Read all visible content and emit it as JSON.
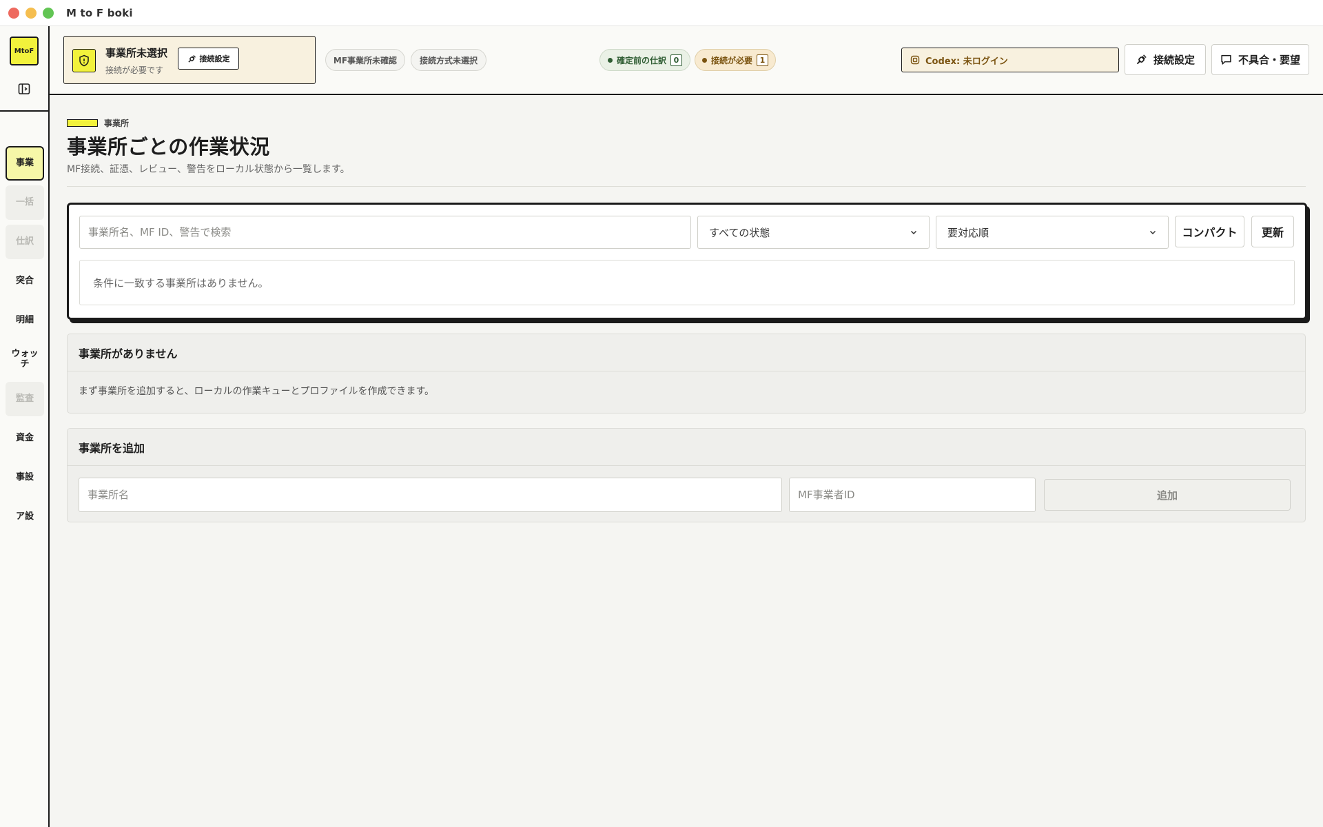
{
  "window": {
    "title": "M to F boki"
  },
  "sidebar": {
    "brand": "MtoF",
    "items": [
      {
        "label": "事業",
        "state": "active"
      },
      {
        "label": "一括",
        "state": "disabled"
      },
      {
        "label": "仕訳",
        "state": "disabled"
      },
      {
        "label": "突合",
        "state": "normal"
      },
      {
        "label": "明細",
        "state": "normal"
      },
      {
        "label": "ウォッチ",
        "state": "normal"
      },
      {
        "label": "監査",
        "state": "disabled"
      },
      {
        "label": "資金",
        "state": "normal"
      },
      {
        "label": "事設",
        "state": "normal"
      },
      {
        "label": "ア設",
        "state": "normal"
      }
    ]
  },
  "header": {
    "office": {
      "title": "事業所未選択",
      "subtitle": "接続が必要です",
      "button_label": "接続設定"
    },
    "pills": {
      "mf_office": "MF事業所未確認",
      "connection_method": "接続方式未選択",
      "pending_label": "確定前の仕訳",
      "pending_count": "0",
      "connect_label": "接続が必要",
      "connect_count": "1"
    },
    "codex_label": "Codex: 未ログイン",
    "connect_settings_label": "接続設定",
    "feedback_label": "不具合・要望"
  },
  "main": {
    "section_label": "事業所",
    "title": "事業所ごとの作業状況",
    "description": "MF接続、証憑、レビュー、警告をローカル状態から一覧します。",
    "filter": {
      "search_placeholder": "事業所名、MF ID、警告で検索",
      "status_select": "すべての状態",
      "sort_select": "要対応順",
      "compact_label": "コンパクト",
      "refresh_label": "更新",
      "empty_message": "条件に一致する事業所はありません。"
    },
    "no_office": {
      "title": "事業所がありません",
      "message": "まず事業所を追加すると、ローカルの作業キューとプロファイルを作成できます。"
    },
    "add_office": {
      "title": "事業所を追加",
      "name_placeholder": "事業所名",
      "mf_id_placeholder": "MF事業者ID",
      "add_label": "追加"
    }
  },
  "colors": {
    "accent_yellow": "#f2f23c",
    "active_nav": "#f6f7a8",
    "pending_green": "#2f5d33",
    "warning_amber": "#7a5310",
    "cream": "#f8f1df"
  }
}
